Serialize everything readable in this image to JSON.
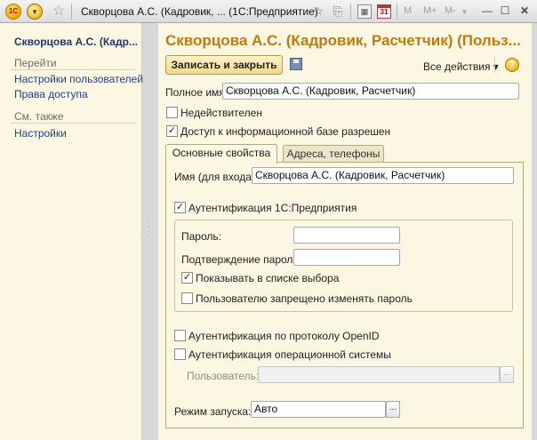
{
  "window": {
    "title": "Скворцова А.С.  (Кадровик, ...  (1С:Предприятие)",
    "logo_text": "1С",
    "memory_buttons": [
      "M",
      "M+",
      "M-"
    ],
    "calendar_day": "31"
  },
  "sidebar": {
    "title": "Скворцова А.С.  (Кадр...",
    "goto_heading": "Перейти",
    "goto_items": [
      "Настройки пользователей",
      "Права доступа"
    ],
    "see_also_heading": "См. также",
    "see_also_items": [
      "Настройки"
    ]
  },
  "form": {
    "title": "Скворцова А.С.  (Кадровик, Расчетчик) (Польз...",
    "save_close_label": "Записать и закрыть",
    "all_actions_label": "Все действия ▾",
    "help_label": "?",
    "full_name_label": "Полное имя:",
    "full_name_value": "Скворцова А.С.  (Кадровик, Расчетчик)",
    "invalid_label": "Недействителен",
    "invalid_checked": false,
    "access_allowed_label": "Доступ к информационной базе разрешен",
    "access_allowed_checked": true
  },
  "tabs": [
    {
      "label": "Основные свойства",
      "active": true
    },
    {
      "label": "Адреса, телефоны",
      "active": false
    }
  ],
  "main_tab": {
    "login_name_label": "Имя (для входа):",
    "login_name_value": "Скворцова А.С.  (Кадровик, Расчетчик)",
    "auth_1c_label": "Аутентификация 1С:Предприятия",
    "auth_1c_checked": true,
    "password_label": "Пароль:",
    "password_value": "",
    "password_confirm_label": "Подтверждение пароля:",
    "password_confirm_value": "",
    "show_in_list_label": "Показывать в списке выбора",
    "show_in_list_checked": true,
    "cannot_change_password_label": "Пользователю запрещено изменять пароль",
    "cannot_change_password_checked": false,
    "openid_label": "Аутентификация по протоколу OpenID",
    "openid_checked": false,
    "os_auth_label": "Аутентификация операционной системы",
    "os_auth_checked": false,
    "os_user_label": "Пользователь:",
    "os_user_value": "",
    "launch_mode_label": "Режим запуска:",
    "launch_mode_value": "Авто",
    "select_button_label": "..."
  }
}
